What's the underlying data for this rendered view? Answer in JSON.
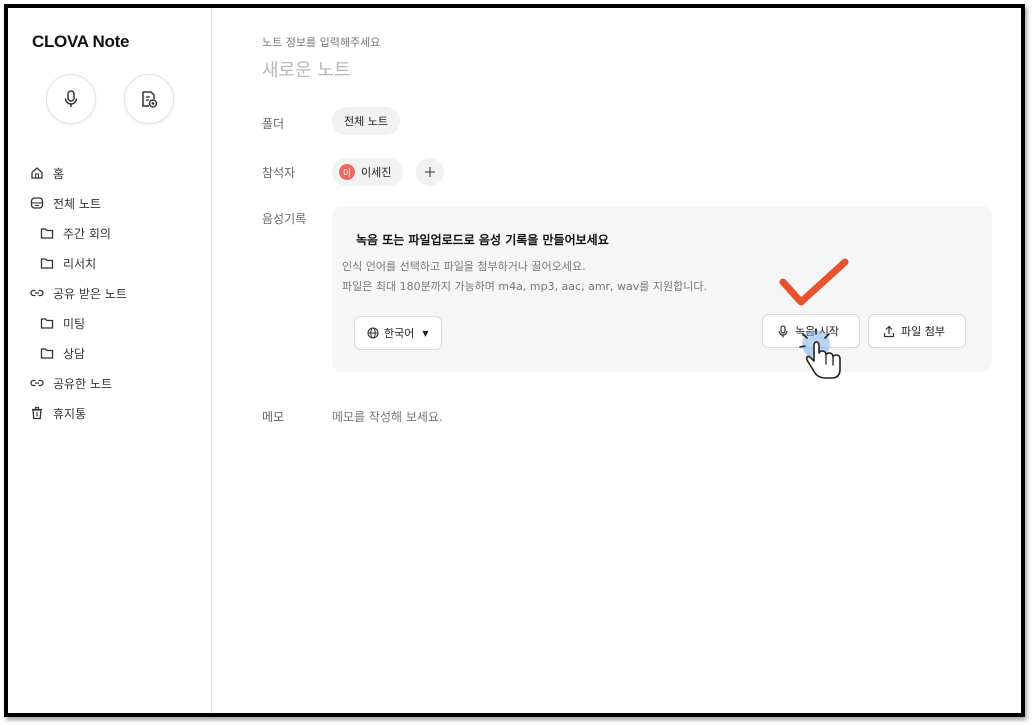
{
  "app": {
    "logo": "CLOVA Note"
  },
  "sidebar": {
    "quick_actions": [
      {
        "icon": "microphone-icon"
      },
      {
        "icon": "file-upload-icon"
      }
    ],
    "items": [
      {
        "label": "홈",
        "icon": "home-icon"
      },
      {
        "label": "전체 노트",
        "icon": "notes-box-icon"
      },
      {
        "label": "주간 회의",
        "icon": "folder-icon"
      },
      {
        "label": "리서치",
        "icon": "folder-icon"
      },
      {
        "label": "공유 받은 노트",
        "icon": "link-icon"
      },
      {
        "label": "미팅",
        "icon": "folder-icon"
      },
      {
        "label": "상담",
        "icon": "folder-icon"
      },
      {
        "label": "공유한 노트",
        "icon": "link-icon"
      },
      {
        "label": "휴지통",
        "icon": "trash-icon"
      }
    ]
  },
  "note": {
    "hint": "노트 정보를 입력해주세요",
    "title_placeholder": "새로운 노트",
    "folder": {
      "label": "폴더",
      "value": "전체 노트"
    },
    "participants": {
      "label": "참석자",
      "people": [
        {
          "initial": "이",
          "name": "이세진",
          "color": "#ee6a5e"
        }
      ]
    },
    "voice": {
      "label": "음성기록",
      "title": "녹음 또는 파일업로드로 음성 기록을 만들어보세요",
      "desc_1": "인식 언어를 선택하고 파일을 첨부하거나 끌어오세요.",
      "desc_2": "파일은 최대 180분까지 가능하며 m4a, mp3, aac, amr, wav를 지원합니다.",
      "language": "한국어",
      "record_button": "녹음 시작",
      "upload_button": "파일 첨부"
    },
    "memo": {
      "label": "메모",
      "placeholder": "메모를 작성해 보세요."
    }
  },
  "annotation": {
    "check_color": "#e8532f"
  }
}
